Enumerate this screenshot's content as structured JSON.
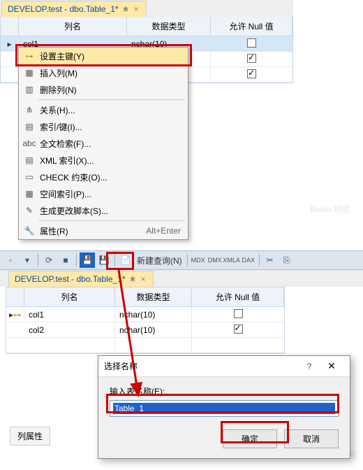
{
  "top": {
    "tab_title": "DEVELOP.test - dbo.Table_1*",
    "columns": {
      "name": "列名",
      "type": "数据类型",
      "null": "允许 Null 值"
    },
    "rows": [
      {
        "name": "col1",
        "type": "nchar(10)",
        "nullable": false,
        "selected": true
      },
      {
        "name": "",
        "type": "",
        "nullable": true,
        "selected": false
      },
      {
        "name": "",
        "type": "",
        "nullable": true,
        "selected": false
      }
    ]
  },
  "menu": {
    "items": [
      {
        "icon": "key-icon",
        "label": "设置主键(Y)",
        "hl": true
      },
      {
        "icon": "insert-icon",
        "label": "插入列(M)"
      },
      {
        "icon": "delete-icon",
        "label": "删除列(N)"
      },
      {
        "sep": true
      },
      {
        "icon": "rel-icon",
        "label": "关系(H)..."
      },
      {
        "icon": "index-icon",
        "label": "索引/键(I)..."
      },
      {
        "icon": "fulltext-icon",
        "label": "全文检索(F)..."
      },
      {
        "icon": "xml-icon",
        "label": "XML 索引(X)..."
      },
      {
        "icon": "check-icon",
        "label": "CHECK 约束(O)..."
      },
      {
        "icon": "spatial-icon",
        "label": "空间索引(P)..."
      },
      {
        "icon": "script-icon",
        "label": "生成更改脚本(S)..."
      },
      {
        "sep": true
      },
      {
        "icon": "props-icon",
        "label": "属性(R)",
        "shortcut": "Alt+Enter"
      }
    ]
  },
  "toolbar": {
    "new_query": "新建查询(N)",
    "icons": [
      "MDX",
      "DMX",
      "XMLA",
      "DAX"
    ]
  },
  "bottom": {
    "tab_title": "DEVELOP.test - dbo.Table_1*",
    "columns": {
      "name": "列名",
      "type": "数据类型",
      "null": "允许 Null 值"
    },
    "rows": [
      {
        "name": "col1",
        "type": "nchar(10)",
        "nullable": false,
        "key": true
      },
      {
        "name": "col2",
        "type": "nchar(10)",
        "nullable": true,
        "key": false
      },
      {
        "name": "",
        "type": "",
        "nullable": null,
        "key": false
      }
    ],
    "col_props_label": "列属性"
  },
  "dialog": {
    "title": "选择名称",
    "label": "输入表名称(E):",
    "value": "Table_1",
    "ok": "确定",
    "cancel": "取消"
  },
  "watermark1": "Baidu 经验",
  "watermark2": "php 中文网"
}
